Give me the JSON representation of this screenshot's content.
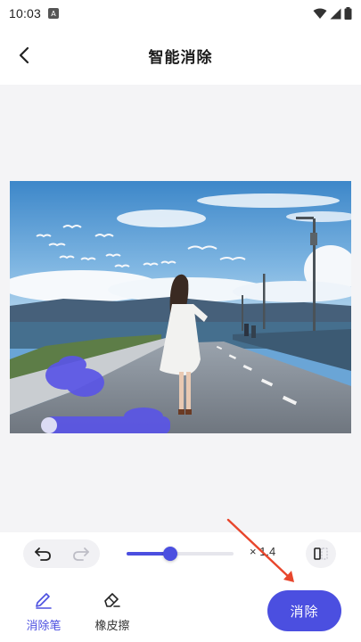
{
  "status_bar": {
    "time": "10:03",
    "app_badge": "A",
    "icons": [
      "wifi-icon",
      "signal-icon",
      "battery-icon"
    ]
  },
  "header": {
    "title": "智能消除",
    "back_icon": "chevron-left-icon"
  },
  "editor": {
    "brush_size": 0.41,
    "zoom_label": "× 1.4"
  },
  "toolbar": {
    "undo_icon": "undo-icon",
    "redo_icon": "redo-icon",
    "compare_icon": "compare-icon"
  },
  "tools": [
    {
      "label": "消除笔",
      "icon": "pen-icon",
      "active": true
    },
    {
      "label": "橡皮擦",
      "icon": "eraser-icon",
      "active": false
    }
  ],
  "action": {
    "erase_label": "消除"
  },
  "colors": {
    "accent": "#4b4fe0",
    "mask": "#5a55e6",
    "annotation_arrow": "#e8462c"
  }
}
